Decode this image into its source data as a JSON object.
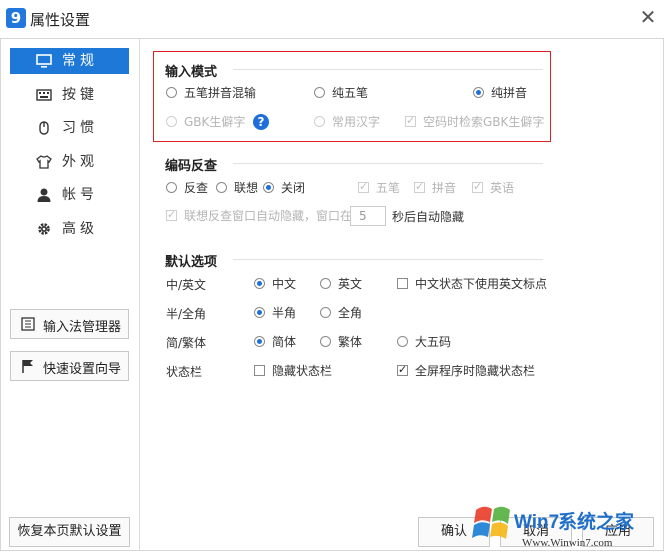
{
  "window": {
    "title": "属性设置",
    "logo_text": "9",
    "close_glyph": "✕"
  },
  "sidebar": {
    "items": [
      {
        "label": "常规",
        "icon": "monitor-icon",
        "active": true
      },
      {
        "label": "按键",
        "icon": "keyboard-icon"
      },
      {
        "label": "习惯",
        "icon": "mouse-icon"
      },
      {
        "label": "外观",
        "icon": "shirt-icon"
      },
      {
        "label": "帐号",
        "icon": "user-icon"
      },
      {
        "label": "高级",
        "icon": "gear-icon"
      }
    ],
    "ime_manager": "输入法管理器",
    "quick_wizard": "快速设置向导",
    "restore_default": "恢复本页默认设置"
  },
  "input_mode": {
    "title": "输入模式",
    "wubi_pinyin": "五笔拼音混输",
    "pure_wubi": "纯五笔",
    "pure_pinyin": "纯拼音",
    "gbk": "GBK生僻字",
    "help_glyph": "?",
    "common_chars": "常用汉字",
    "empty_code_search": "空码时检索GBK生僻字"
  },
  "reverse_lookup": {
    "title": "编码反查",
    "reverse": "反查",
    "assoc": "联想",
    "off": "关闭",
    "wubi": "五笔",
    "pinyin": "拼音",
    "english": "英语",
    "auto_hide_pre": "联想反查窗口自动隐藏，窗口在",
    "seconds": "5",
    "auto_hide_post": "秒后自动隐藏"
  },
  "defaults": {
    "title": "默认选项",
    "cn_en": {
      "label": "中/英文",
      "chinese": "中文",
      "english": "英文",
      "cn_en_punct": "中文状态下使用英文标点"
    },
    "half_full": {
      "label": "半/全角",
      "half": "半角",
      "full": "全角"
    },
    "simp_trad": {
      "label": "简/繁体",
      "simplified": "简体",
      "traditional": "繁体",
      "big5": "大五码"
    },
    "status_bar": {
      "label": "状态栏",
      "hide": "隐藏状态栏",
      "fullscreen_hide": "全屏程序时隐藏状态栏"
    }
  },
  "footer": {
    "confirm": "确认",
    "cancel": "取消",
    "apply": "应用"
  },
  "watermark": {
    "brand_a": "Win7",
    "brand_b": "系统之家",
    "url": "Www.Winwin7.com"
  },
  "colors": {
    "accent": "#1e78d7",
    "highlight_box": "#e02020"
  }
}
